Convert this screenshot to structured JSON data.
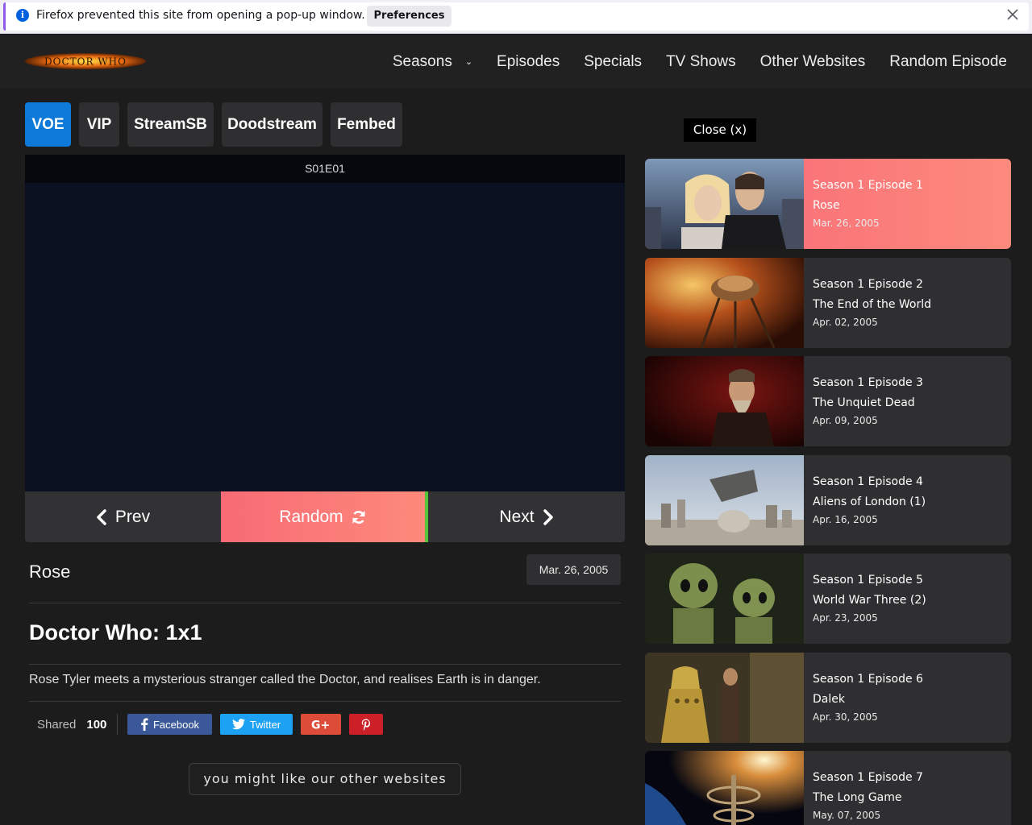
{
  "notification": {
    "text": "Firefox prevented this site from opening a pop-up window.",
    "button_label": "Preferences"
  },
  "logo_text": "DOCTOR WHO",
  "nav": {
    "items": [
      "Seasons",
      "Episodes",
      "Specials",
      "TV Shows",
      "Other Websites",
      "Random Episode"
    ]
  },
  "servers": [
    "VOE",
    "VIP",
    "StreamSB",
    "Doodstream",
    "Fembed"
  ],
  "active_server": "VOE",
  "player": {
    "title": "S01E01"
  },
  "controls": {
    "prev": "Prev",
    "random": "Random",
    "next": "Next"
  },
  "episode": {
    "title": "Rose",
    "date": "Mar. 26, 2005",
    "heading": "Doctor Who: 1x1",
    "synopsis": "Rose Tyler meets a mysterious stranger called the Doctor, and realises Earth is in danger."
  },
  "share": {
    "label": "Shared",
    "count": "100",
    "facebook": "Facebook",
    "twitter": "Twitter"
  },
  "other_sites_label": "you might like our other websites",
  "sidebar": {
    "close_label": "Close (x)",
    "episodes": [
      {
        "sn": "Season 1 Episode 1",
        "name": "Rose",
        "date": "Mar. 26, 2005"
      },
      {
        "sn": "Season 1 Episode 2",
        "name": "The End of the World",
        "date": "Apr. 02, 2005"
      },
      {
        "sn": "Season 1 Episode 3",
        "name": "The Unquiet Dead",
        "date": "Apr. 09, 2005"
      },
      {
        "sn": "Season 1 Episode 4",
        "name": "Aliens of London (1)",
        "date": "Apr. 16, 2005"
      },
      {
        "sn": "Season 1 Episode 5",
        "name": "World War Three (2)",
        "date": "Apr. 23, 2005"
      },
      {
        "sn": "Season 1 Episode 6",
        "name": "Dalek",
        "date": "Apr. 30, 2005"
      },
      {
        "sn": "Season 1 Episode 7",
        "name": "The Long Game",
        "date": "May. 07, 2005"
      }
    ]
  },
  "colors": {
    "accent_blue": "#0d79d8",
    "accent_coral": "#f86b76",
    "background": "#1c1c1d"
  }
}
